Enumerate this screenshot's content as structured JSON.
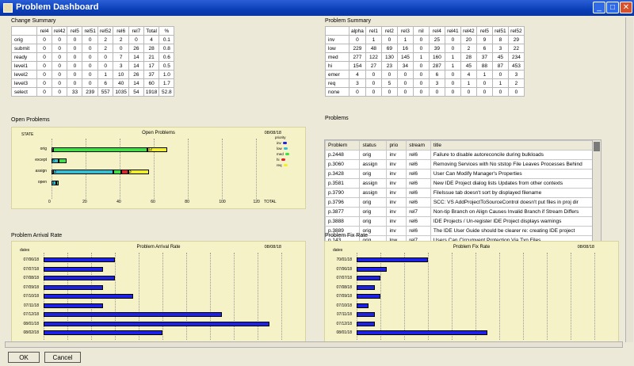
{
  "window": {
    "title": "Problem Dashboard"
  },
  "change_summary": {
    "title": "Change Summary",
    "headers": [
      "",
      "rel4",
      "rel42",
      "rel5",
      "rel51",
      "rel52",
      "rel6",
      "rel7",
      "Total",
      "%"
    ],
    "rows": [
      [
        "orig",
        "0",
        "0",
        "0",
        "0",
        "2",
        "2",
        "0",
        "4",
        "0.1"
      ],
      [
        "submit",
        "0",
        "0",
        "0",
        "0",
        "2",
        "0",
        "26",
        "28",
        "0.8"
      ],
      [
        "ready",
        "0",
        "0",
        "0",
        "0",
        "0",
        "7",
        "14",
        "21",
        "0.6"
      ],
      [
        "level1",
        "0",
        "0",
        "0",
        "0",
        "0",
        "3",
        "14",
        "17",
        "0.5"
      ],
      [
        "level2",
        "0",
        "0",
        "0",
        "0",
        "1",
        "10",
        "26",
        "37",
        "1.0"
      ],
      [
        "level3",
        "0",
        "0",
        "0",
        "0",
        "6",
        "40",
        "14",
        "60",
        "1.7"
      ],
      [
        "select",
        "0",
        "0",
        "33",
        "239",
        "557",
        "1035",
        "54",
        "1918",
        "52.8"
      ]
    ]
  },
  "problem_summary": {
    "title": "Problem Summary",
    "headers": [
      "",
      "alpha",
      "rel1",
      "rel2",
      "rel3",
      "nil",
      "rel4",
      "rel41",
      "rel42",
      "rel5",
      "rel51",
      "rel52"
    ],
    "rows": [
      [
        "inv",
        "0",
        "1",
        "0",
        "1",
        "0",
        "25",
        "0",
        "20",
        "9",
        "8",
        "29"
      ],
      [
        "low",
        "229",
        "48",
        "69",
        "16",
        "0",
        "39",
        "0",
        "2",
        "6",
        "3",
        "22"
      ],
      [
        "med",
        "277",
        "122",
        "130",
        "145",
        "1",
        "160",
        "1",
        "28",
        "37",
        "45",
        "234"
      ],
      [
        "hi",
        "154",
        "27",
        "23",
        "34",
        "0",
        "287",
        "1",
        "45",
        "88",
        "87",
        "453"
      ],
      [
        "emer",
        "4",
        "0",
        "0",
        "0",
        "0",
        "6",
        "0",
        "4",
        "1",
        "0",
        "3"
      ],
      [
        "req",
        "3",
        "0",
        "5",
        "0",
        "0",
        "3",
        "0",
        "1",
        "0",
        "1",
        "2"
      ],
      [
        "none",
        "0",
        "0",
        "0",
        "0",
        "0",
        "0",
        "0",
        "0",
        "0",
        "0",
        "0"
      ]
    ]
  },
  "open_problems": {
    "title": "Open Problems",
    "date": "08/08/18",
    "ylabel": "STATE",
    "xlabel": "TOTAL",
    "legend_title": "priority",
    "legend": [
      {
        "name": "inv",
        "color": "#1e22e6"
      },
      {
        "name": "low",
        "color": "#2ec2d6"
      },
      {
        "name": "med",
        "color": "#36e63a"
      },
      {
        "name": "hi",
        "color": "#e62222"
      },
      {
        "name": "req",
        "color": "#f2f21a"
      }
    ]
  },
  "chart_data": [
    {
      "type": "bar",
      "title": "Open Problems",
      "xlabel": "TOTAL",
      "ylabel": "STATE",
      "categories": [
        "orig",
        "except",
        "assign",
        "open"
      ],
      "xlim": [
        0,
        130
      ],
      "xticks": [
        "0",
        "20",
        "40",
        "60",
        "80",
        "100",
        "120"
      ],
      "stacked": true,
      "series": [
        {
          "name": "inv",
          "color": "#1e22e6",
          "values": [
            1,
            0,
            1,
            0
          ]
        },
        {
          "name": "low",
          "color": "#2ec2d6",
          "values": [
            0,
            4,
            35,
            3
          ]
        },
        {
          "name": "med",
          "color": "#36e63a",
          "values": [
            55,
            5,
            5,
            1
          ]
        },
        {
          "name": "hi",
          "color": "#e62222",
          "values": [
            0,
            0,
            4,
            0
          ]
        },
        {
          "name": "req",
          "color": "#f2f21a",
          "values": [
            12,
            0,
            12,
            0
          ]
        }
      ],
      "data_labels": [
        [
          "5",
          "",
          "",
          "",
          "12"
        ],
        [
          "",
          "8",
          "",
          "",
          ""
        ],
        [
          "5",
          "3",
          "",
          "",
          "3"
        ],
        [
          "",
          "1",
          "",
          "",
          ""
        ]
      ]
    },
    {
      "type": "bar",
      "title": "Problem Arrival Rate",
      "ylabel": "dates",
      "categories": [
        "07/06/18",
        "07/07/18",
        "07/08/18",
        "07/09/18",
        "07/10/18",
        "07/11/18",
        "07/12/18",
        "08/01/18",
        "08/02/18"
      ],
      "values": [
        12,
        10,
        12,
        10,
        15,
        10,
        30,
        38,
        20
      ]
    },
    {
      "type": "bar",
      "title": "Problem Fix Rate",
      "ylabel": "dates",
      "categories": [
        "70/01/18",
        "07/06/18",
        "07/07/18",
        "07/08/18",
        "07/09/18",
        "07/10/18",
        "07/11/18",
        "07/12/18",
        "08/01/18"
      ],
      "values": [
        12,
        5,
        4,
        3,
        4,
        2,
        3,
        3,
        22
      ]
    }
  ],
  "problems": {
    "title": "Problems",
    "headers": [
      "Problem",
      "status",
      "prio",
      "stream",
      "title"
    ],
    "rows": [
      [
        "p.2448",
        "orig",
        "inv",
        "rel6",
        "Failure to disable autoreconcile during bulkloads"
      ],
      [
        "p.3060",
        "assign",
        "inv",
        "rel6",
        "Removing Services with No ststop File Leaves Processes Behind"
      ],
      [
        "p.3428",
        "orig",
        "inv",
        "rel6",
        "User Can Modify Manager's Properties"
      ],
      [
        "p.3581",
        "assign",
        "inv",
        "rel6",
        "New IDE Project dialog lists Updates from other contexts"
      ],
      [
        "p.3790",
        "assign",
        "inv",
        "rel6",
        "FileIssue tab doesn't sort by displayed filename"
      ],
      [
        "p.3796",
        "orig",
        "inv",
        "rel6",
        "SCC: VS AddProjectToSourceControl doesn't put files in proj dir"
      ],
      [
        "p.3877",
        "orig",
        "inv",
        "rel7",
        "Non-tip Branch on Align Causes Invalid Branch if Stream Differs"
      ],
      [
        "p.3888",
        "orig",
        "inv",
        "rel6",
        "IDE Projects / Un-register IDE Project displays warnings"
      ],
      [
        "p.3889",
        "orig",
        "inv",
        "rel6",
        "The IDE User Guide should be clearer re: creating IDE project"
      ],
      [
        "p.143",
        "orig",
        "low",
        "rel7",
        "Users Can Circumvent Protection Via Txn Files"
      ]
    ]
  },
  "arrival": {
    "title": "Problem Arrival Rate",
    "section": "Problem Arrival Rate",
    "date": "08/08/18",
    "ylabel": "dates"
  },
  "fix": {
    "title": "Problem Fix Rate",
    "section": "Problem Fix Rate",
    "date": "08/08/18",
    "ylabel": "dates"
  },
  "buttons": {
    "ok": "OK",
    "cancel": "Cancel"
  }
}
